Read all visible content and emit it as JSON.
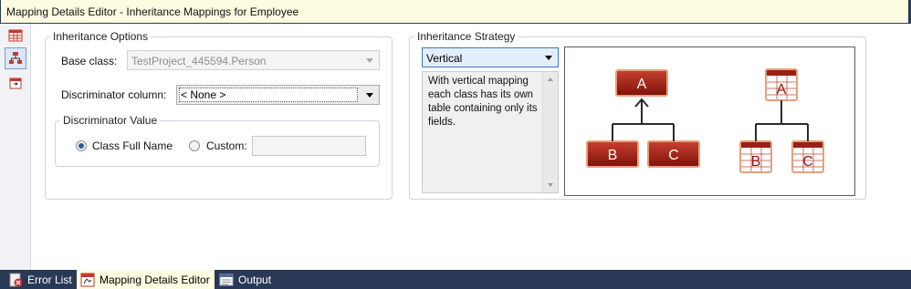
{
  "window": {
    "title": "Mapping Details Editor - Inheritance Mappings for  Employee"
  },
  "sidebar": {
    "icons": [
      "table-mapping-icon",
      "inheritance-mapping-icon",
      "function-mapping-icon"
    ],
    "selected": 1
  },
  "inheritance_options": {
    "title": "Inheritance Options",
    "base_class_label": "Base class:",
    "base_class_value": "TestProject_445594.Person",
    "discriminator_column_label": "Discriminator column:",
    "discriminator_column_value": "< None >",
    "discriminator_value": {
      "title": "Discriminator Value",
      "option_class_full_name": "Class Full Name",
      "option_custom": "Custom:",
      "selected": "Class Full Name",
      "custom_value": ""
    }
  },
  "inheritance_strategy": {
    "title": "Inheritance Strategy",
    "selected": "Vertical",
    "description": "With vertical mapping each class has its own table containing only its fields.",
    "diagram": {
      "left_classes": [
        "A",
        "B",
        "C"
      ],
      "right_tables": [
        "A",
        "B",
        "C"
      ],
      "box_color": "#b3261e"
    }
  },
  "bottom_tabs": [
    {
      "label": "Error List",
      "icon": "error-list-icon"
    },
    {
      "label": "Mapping Details Editor",
      "icon": "mapping-editor-icon",
      "active": true
    },
    {
      "label": "Output",
      "icon": "output-icon"
    }
  ]
}
